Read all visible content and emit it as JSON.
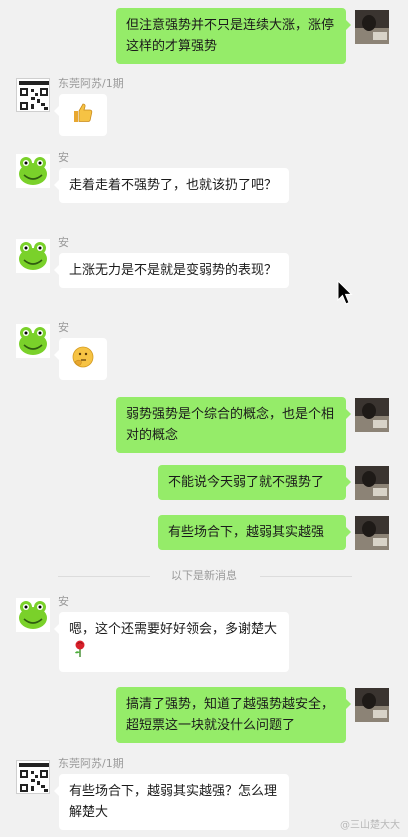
{
  "messages": [
    {
      "side": "right",
      "text": "但注意强势并不只是连续大涨，涨停这样的才算强势"
    },
    {
      "side": "left",
      "sender": "东莞阿苏/1期",
      "emoji": "thumbs-up"
    },
    {
      "side": "left",
      "sender": "安",
      "text": "走着走着不强势了，也就该扔了吧？"
    },
    {
      "side": "left",
      "sender": "安",
      "text": "上涨无力是不是就是变弱势的表现？"
    },
    {
      "side": "left",
      "sender": "安",
      "emoji": "thinking-face"
    },
    {
      "side": "right",
      "text": "弱势强势是个综合的概念，也是个相对的概念"
    },
    {
      "side": "right",
      "text": "不能说今天弱了就不强势了"
    },
    {
      "side": "right",
      "text": "有些场合下，越弱其实越强"
    },
    {
      "side": "left",
      "sender": "安",
      "text": "嗯，这个还需要好好领会，多谢楚大",
      "emoji": "rose"
    },
    {
      "side": "right",
      "text": "搞清了强势，知道了越强势越安全，超短票这一块就没什么问题了"
    },
    {
      "side": "left",
      "sender": "东莞阿苏/1期",
      "text": "有些场合下，越弱其实越强？怎么理解楚大"
    }
  ],
  "divider": {
    "text": "以下是新消息"
  },
  "watermark": "@三山楚大大",
  "colors": {
    "right_bubble": "#95ec69",
    "left_bubble": "#ffffff",
    "background": "#f1f1f1"
  }
}
